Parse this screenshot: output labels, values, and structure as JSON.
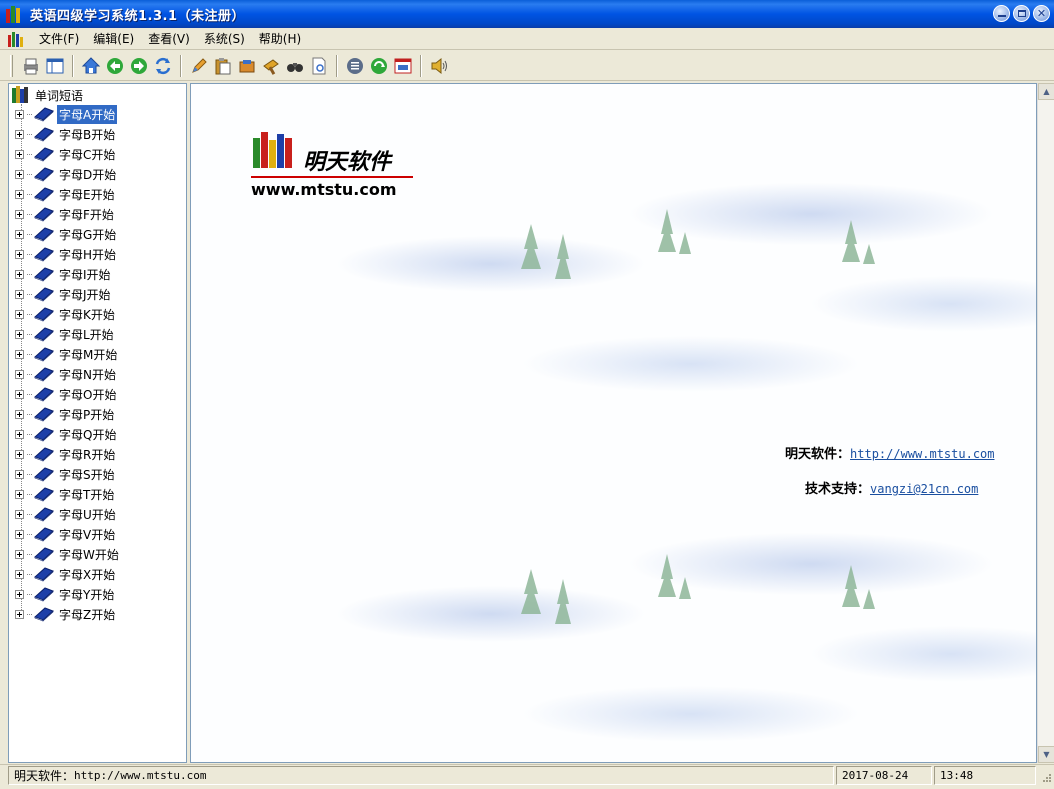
{
  "window": {
    "title": "英语四级学习系统1.3.1（未注册）"
  },
  "menu": {
    "items": [
      "文件(F)",
      "编辑(E)",
      "查看(V)",
      "系统(S)",
      "帮助(H)"
    ]
  },
  "toolbar": {
    "buttons": [
      "print-icon",
      "layout-icon",
      "home-icon",
      "back-icon",
      "forward-icon",
      "refresh-icon",
      "edit-icon",
      "paste-icon",
      "cut-icon",
      "hammer-icon",
      "find-icon",
      "document-icon",
      "list-icon",
      "recycle-icon",
      "window-icon",
      "speaker-icon"
    ]
  },
  "tree": {
    "root": "单词短语",
    "items": [
      "字母A开始",
      "字母B开始",
      "字母C开始",
      "字母D开始",
      "字母E开始",
      "字母F开始",
      "字母G开始",
      "字母H开始",
      "字母I开始",
      "字母J开始",
      "字母K开始",
      "字母L开始",
      "字母M开始",
      "字母N开始",
      "字母O开始",
      "字母P开始",
      "字母Q开始",
      "字母R开始",
      "字母S开始",
      "字母T开始",
      "字母U开始",
      "字母V开始",
      "字母W开始",
      "字母X开始",
      "字母Y开始",
      "字母Z开始"
    ],
    "selected": "字母A开始"
  },
  "content": {
    "logo_name": "明天软件",
    "logo_url": "www.mtstu.com",
    "website_label": "明天软件：",
    "website_link": "http://www.mtstu.com",
    "support_label": "技术支持：",
    "support_link": "vangzi@21cn.com"
  },
  "statusbar": {
    "left_label": "明天软件：",
    "left_url": "http://www.mtstu.com",
    "date": "2017-08-24",
    "time": "13:48"
  },
  "colors": {
    "titlebar": "#0054E3",
    "selection": "#316AC5",
    "link": "#1a4fa0",
    "book_blue": "#1d3fa8"
  }
}
